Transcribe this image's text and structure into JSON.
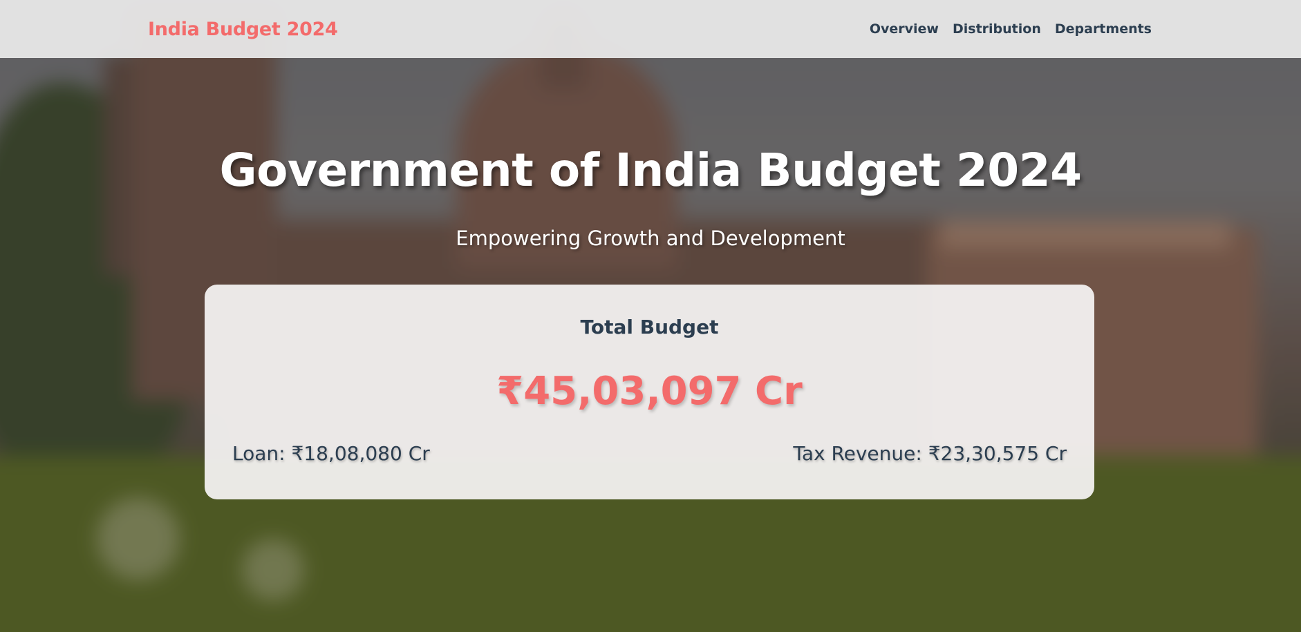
{
  "nav": {
    "brand": "India Budget 2024",
    "links": [
      "Overview",
      "Distribution",
      "Departments"
    ]
  },
  "hero": {
    "title": "Government of India Budget 2024",
    "subtitle": "Empowering Growth and Development"
  },
  "card": {
    "heading": "Total Budget",
    "total": "₹45,03,097 Cr",
    "loan": "Loan: ₹18,08,080 Cr",
    "tax_revenue": "Tax Revenue: ₹23,30,575 Cr"
  },
  "colors": {
    "accent": "#f36b6b",
    "text_dark": "#2c3e50",
    "nav_bg": "#e8e8e8"
  }
}
